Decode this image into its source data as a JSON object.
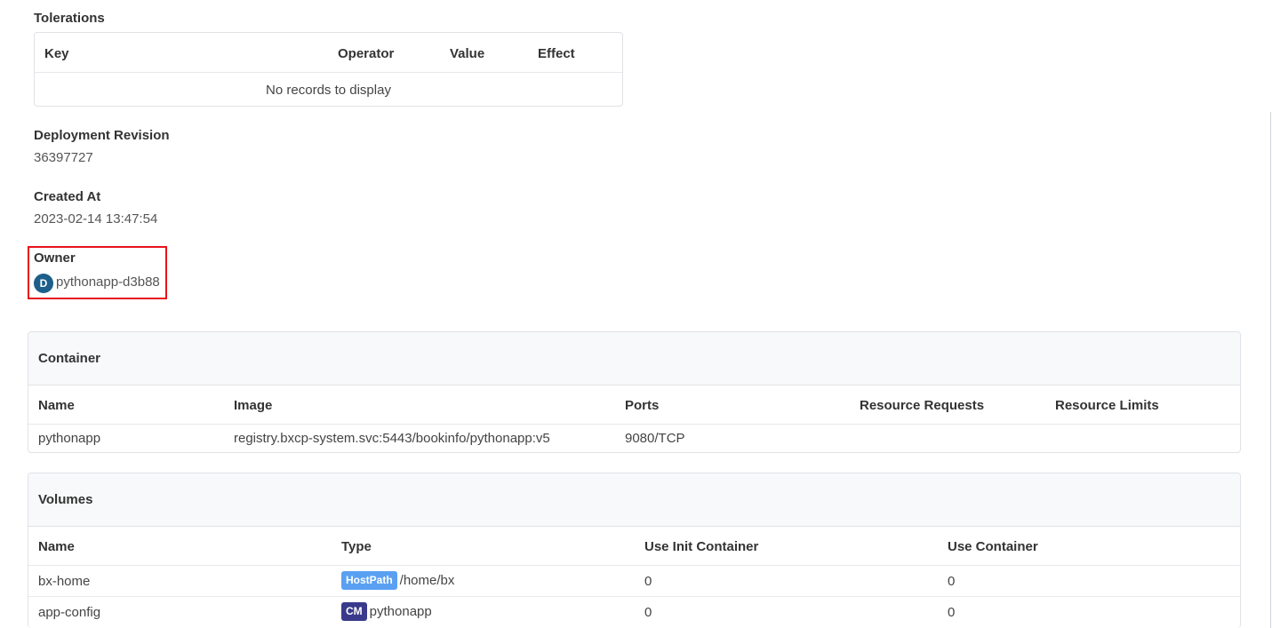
{
  "tolerations": {
    "title": "Tolerations",
    "columns": [
      "Key",
      "Operator",
      "Value",
      "Effect"
    ],
    "empty_text": "No records to display"
  },
  "deployment_revision": {
    "label": "Deployment Revision",
    "value": "36397727"
  },
  "created_at": {
    "label": "Created At",
    "value": "2023-02-14 13:47:54"
  },
  "owner": {
    "label": "Owner",
    "badge": "D",
    "name": "pythonapp-d3b88",
    "highlight_color": "#e8121b"
  },
  "container": {
    "title": "Container",
    "columns": [
      "Name",
      "Image",
      "Ports",
      "Resource Requests",
      "Resource Limits"
    ],
    "rows": [
      {
        "name": "pythonapp",
        "image": "registry.bxcp-system.svc:5443/bookinfo/pythonapp:v5",
        "ports": "9080/TCP",
        "requests": "",
        "limits": ""
      }
    ]
  },
  "volumes": {
    "title": "Volumes",
    "columns": [
      "Name",
      "Type",
      "Use Init Container",
      "Use Container"
    ],
    "rows": [
      {
        "name": "bx-home",
        "type_tag": "HostPath",
        "type_value": "/home/bx",
        "init": "0",
        "container": "0"
      },
      {
        "name": "app-config",
        "type_tag": "CM",
        "type_value": "pythonapp",
        "init": "0",
        "container": "0"
      }
    ]
  }
}
